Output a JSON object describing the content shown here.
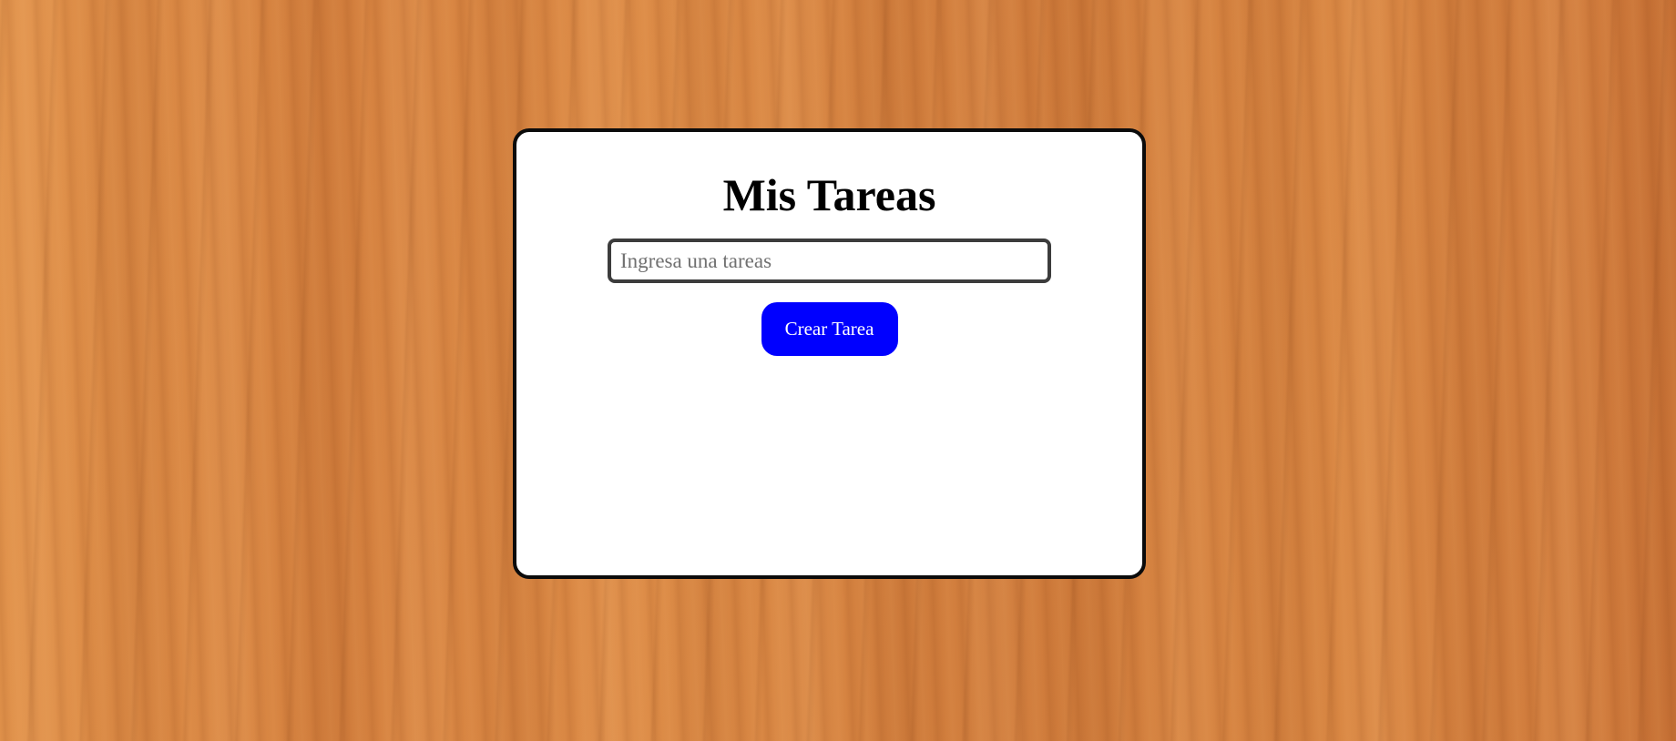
{
  "app": {
    "title": "Mis Tareas"
  },
  "form": {
    "input_value": "",
    "input_placeholder": "Ingresa una tareas",
    "submit_label": "Crear Tarea"
  },
  "tasks": [],
  "colors": {
    "button_background": "#0000ff",
    "button_text": "#ffffff",
    "card_background": "#ffffff",
    "card_border": "#0b0b0b",
    "background_wood": "#d9843f"
  }
}
